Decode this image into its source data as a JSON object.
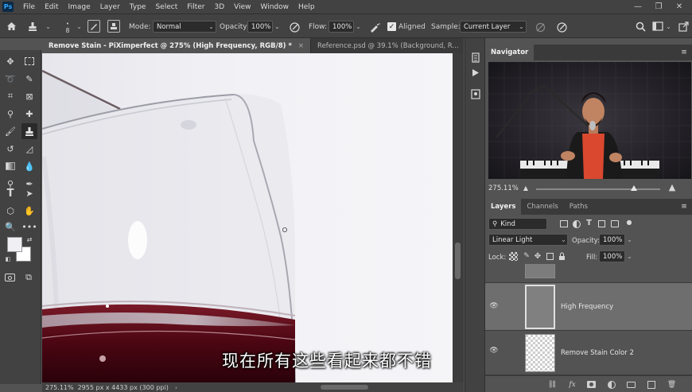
{
  "menu": [
    "File",
    "Edit",
    "Image",
    "Layer",
    "Type",
    "Select",
    "Filter",
    "3D",
    "View",
    "Window",
    "Help"
  ],
  "logo": "Ps",
  "options": {
    "brush_size": "8",
    "mode_label": "Mode:",
    "mode_value": "Normal",
    "opacity_label": "Opacity:",
    "opacity_value": "100%",
    "flow_label": "Flow:",
    "flow_value": "100%",
    "aligned_label": "Aligned",
    "sample_label": "Sample:",
    "sample_value": "Current Layer"
  },
  "tabs": [
    {
      "label": "Remove Stain - PiXimperfect @ 275% (High Frequency, RGB/8) *",
      "close": "×"
    },
    {
      "label": "Reference.psd @ 39.1% (Background, R...",
      "close": "×"
    }
  ],
  "status": {
    "zoom": "275.11%",
    "dimensions": "2955 px x 4433 px (300 ppi)",
    "arrow": "›"
  },
  "subtitle": "现在所有这些看起来都不错",
  "navigator": {
    "title": "Navigator",
    "zoom": "275.11%",
    "zoom_level": 0.79
  },
  "layers_panel": {
    "tabs": [
      "Layers",
      "Channels",
      "Paths"
    ],
    "filter_value": "Kind",
    "blend_mode": "Linear Light",
    "opacity_label": "Opacity:",
    "opacity_value": "100%",
    "lock_label": "Lock:",
    "fill_label": "Fill:",
    "fill_value": "100%",
    "layers": [
      {
        "name": ""
      },
      {
        "name": "High Frequency"
      },
      {
        "name": "Remove Stain Color 2"
      }
    ]
  },
  "colors": {
    "accent": "#31a8ff",
    "wine": "#5c0a18"
  }
}
